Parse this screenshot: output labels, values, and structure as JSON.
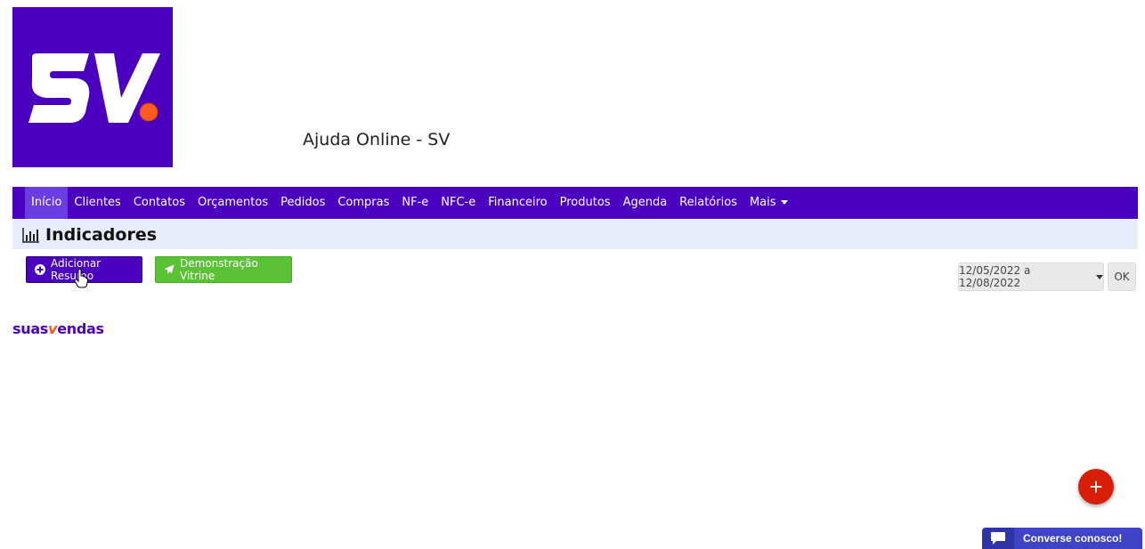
{
  "logo": {
    "text": "SV",
    "bg_color": "#4b00c0",
    "dot_color": "#ff5a1f"
  },
  "site_title": "Ajuda Online - SV",
  "nav": {
    "items": [
      "Início",
      "Clientes",
      "Contatos",
      "Orçamentos",
      "Pedidos",
      "Compras",
      "NF-e",
      "NFC-e",
      "Financeiro",
      "Produtos",
      "Agenda",
      "Relatórios",
      "Mais"
    ],
    "active_index": 0,
    "bg_color": "#4b00c0"
  },
  "page_header": {
    "title": "Indicadores",
    "icon": "bar-chart-icon"
  },
  "actions": {
    "add_summary_label": "Adicionar Resumo",
    "demo_label": "Demonstração Vitrine"
  },
  "date_filter": {
    "range": "12/05/2022 a 12/08/2022",
    "ok_label": "OK"
  },
  "brand": {
    "part1": "suas",
    "part2": "v",
    "part3": "endas"
  },
  "fab": {
    "label": "+",
    "color": "#d81e06"
  },
  "chat": {
    "label": "Converse conosco!"
  }
}
